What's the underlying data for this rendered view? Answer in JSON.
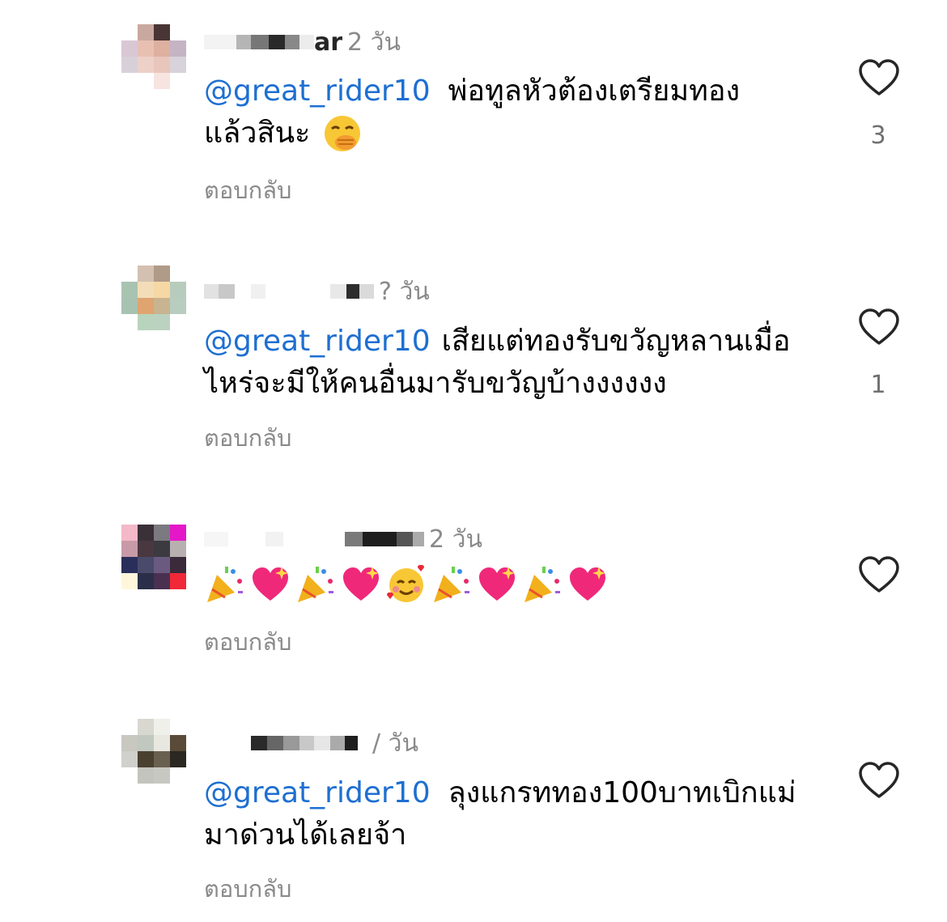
{
  "reply_label": "ตอบกลับ",
  "comments": [
    {
      "author_partial": "ar",
      "time": "2 วัน",
      "mention": "@great_rider10",
      "line1": "พ่อทูลหัวต้องเตรียมทอง",
      "line2": "แล้วสินะ",
      "likes": "3",
      "emoji": "face-with-hand-over-mouth"
    },
    {
      "time": "? วัน",
      "mention": "@great_rider10",
      "line1": "เสียแต่ทองรับขวัญหลานเมื่อ",
      "line2": "ไหร่จะมีให้คนอื่นมารับขวัญบ้างงงงงง",
      "likes": "1"
    },
    {
      "time": "2 วัน",
      "emojis": [
        "party-popper",
        "sparkling-heart",
        "party-popper",
        "sparkling-heart",
        "smiling-face-with-hearts",
        "party-popper",
        "sparkling-heart",
        "party-popper",
        "sparkling-heart"
      ]
    },
    {
      "time": "/ วัน",
      "mention": "@great_rider10",
      "line1": "ลุงแกรททอง100บาทเบิกแม่",
      "line2": "มาด่วนได้เลยจ้า"
    }
  ],
  "colors": {
    "mention": "#1e6fd1",
    "muted": "#8a8a8a"
  }
}
